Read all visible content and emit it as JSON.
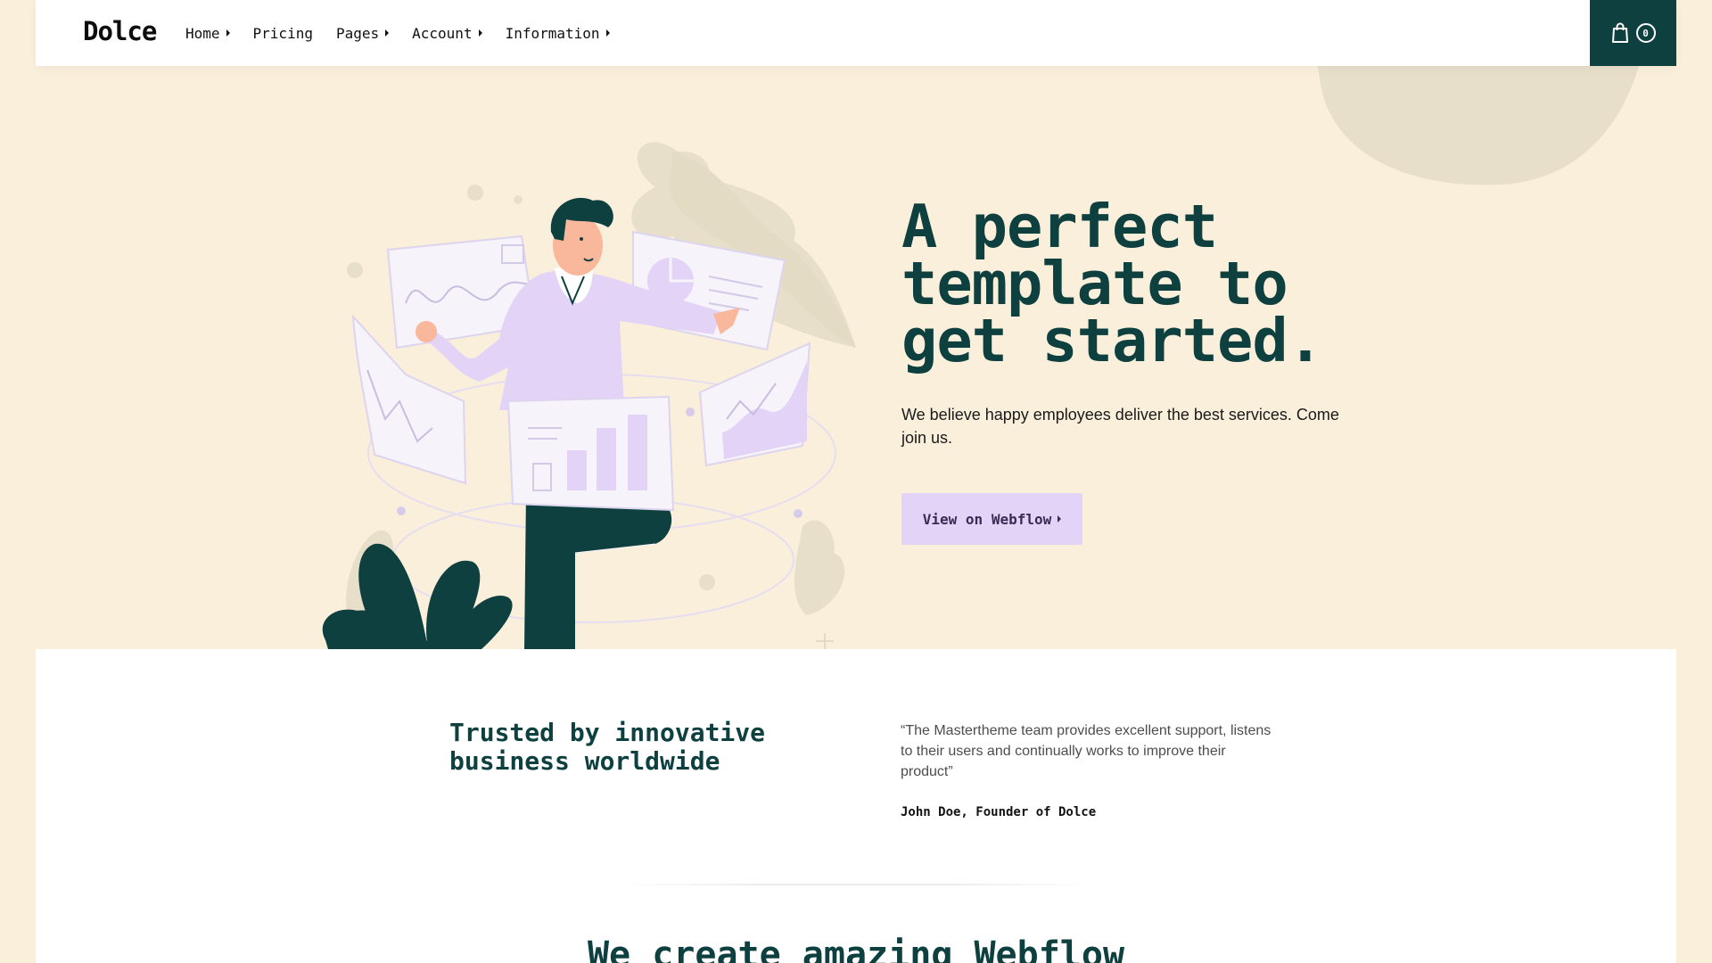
{
  "brand": {
    "name": "Dolce"
  },
  "nav": {
    "items": [
      {
        "label": "Home",
        "has_dropdown": true
      },
      {
        "label": "Pricing",
        "has_dropdown": false
      },
      {
        "label": "Pages",
        "has_dropdown": true
      },
      {
        "label": "Account",
        "has_dropdown": true
      },
      {
        "label": "Information",
        "has_dropdown": true
      }
    ]
  },
  "cart": {
    "icon": "shopping-bag-icon",
    "count": "0"
  },
  "hero": {
    "title": "A perfect template to get started.",
    "subtitle": "We believe happy employees deliver the best services. Come join us.",
    "cta_label": "View on Webflow"
  },
  "testimonial": {
    "heading": "Trusted by innovative business worldwide",
    "quote": "“The Mastertheme team provides excellent support, listens to their users and continually works to improve their product”",
    "author": "John Doe, Founder of Dolce"
  },
  "section": {
    "title": "We create amazing Webflow"
  },
  "colors": {
    "background": "#faefdb",
    "primary": "#0e4040",
    "accent": "#e3d4f7",
    "surface": "#ffffff"
  }
}
